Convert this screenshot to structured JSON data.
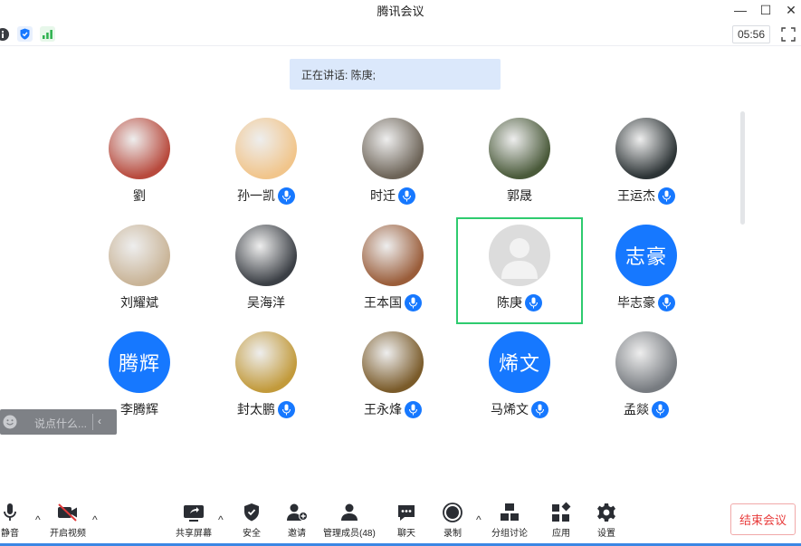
{
  "window": {
    "title": "腾讯会议",
    "minimize": "—",
    "maximize": "☐",
    "close": "✕"
  },
  "infobar": {
    "timer": "05:56"
  },
  "speaking": {
    "label": "正在讲话: 陈庚;"
  },
  "participants": [
    {
      "name": "劉",
      "mic": false,
      "avatar": "photo",
      "bg": "#b84a3d"
    },
    {
      "name": "孙一凯",
      "mic": true,
      "avatar": "photo",
      "bg": "#f1c58b"
    },
    {
      "name": "时迁",
      "mic": true,
      "avatar": "photo",
      "bg": "#6d6458"
    },
    {
      "name": "郭晟",
      "mic": false,
      "avatar": "photo",
      "bg": "#4a5a3a"
    },
    {
      "name": "王运杰",
      "mic": true,
      "avatar": "photo",
      "bg": "#2d3436"
    },
    {
      "name": "刘耀斌",
      "mic": false,
      "avatar": "photo",
      "bg": "#c9b497"
    },
    {
      "name": "吴海洋",
      "mic": false,
      "avatar": "photo",
      "bg": "#3b3f45"
    },
    {
      "name": "王本国",
      "mic": true,
      "avatar": "photo",
      "bg": "#9a5d3a"
    },
    {
      "name": "陈庚",
      "mic": true,
      "avatar": "default",
      "selected": true
    },
    {
      "name": "毕志豪",
      "mic": true,
      "avatar": "text",
      "text": "志豪"
    },
    {
      "name": "李腾辉",
      "mic": false,
      "avatar": "text",
      "text": "腾辉"
    },
    {
      "name": "封太鹏",
      "mic": true,
      "avatar": "photo",
      "bg": "#c29a3b"
    },
    {
      "name": "王永烽",
      "mic": true,
      "avatar": "photo",
      "bg": "#7a5b2a"
    },
    {
      "name": "马烯文",
      "mic": true,
      "avatar": "text",
      "text": "烯文"
    },
    {
      "name": "孟燚",
      "mic": true,
      "avatar": "photo",
      "bg": "#777b80"
    }
  ],
  "chat": {
    "placeholder": "说点什么...",
    "collapse": "‹"
  },
  "toolbar": {
    "mute": "静音",
    "video": "开启视频",
    "share": "共享屏幕",
    "security": "安全",
    "invite": "邀请",
    "members": "管理成员(48)",
    "chat": "聊天",
    "record": "录制",
    "breakout": "分组讨论",
    "apps": "应用",
    "settings": "设置",
    "end": "结束会议"
  },
  "colors": {
    "accent": "#1678ff",
    "speaking_bg": "#dbe8fb",
    "selected_border": "#2ecb6f",
    "end_text": "#e83b3b"
  }
}
